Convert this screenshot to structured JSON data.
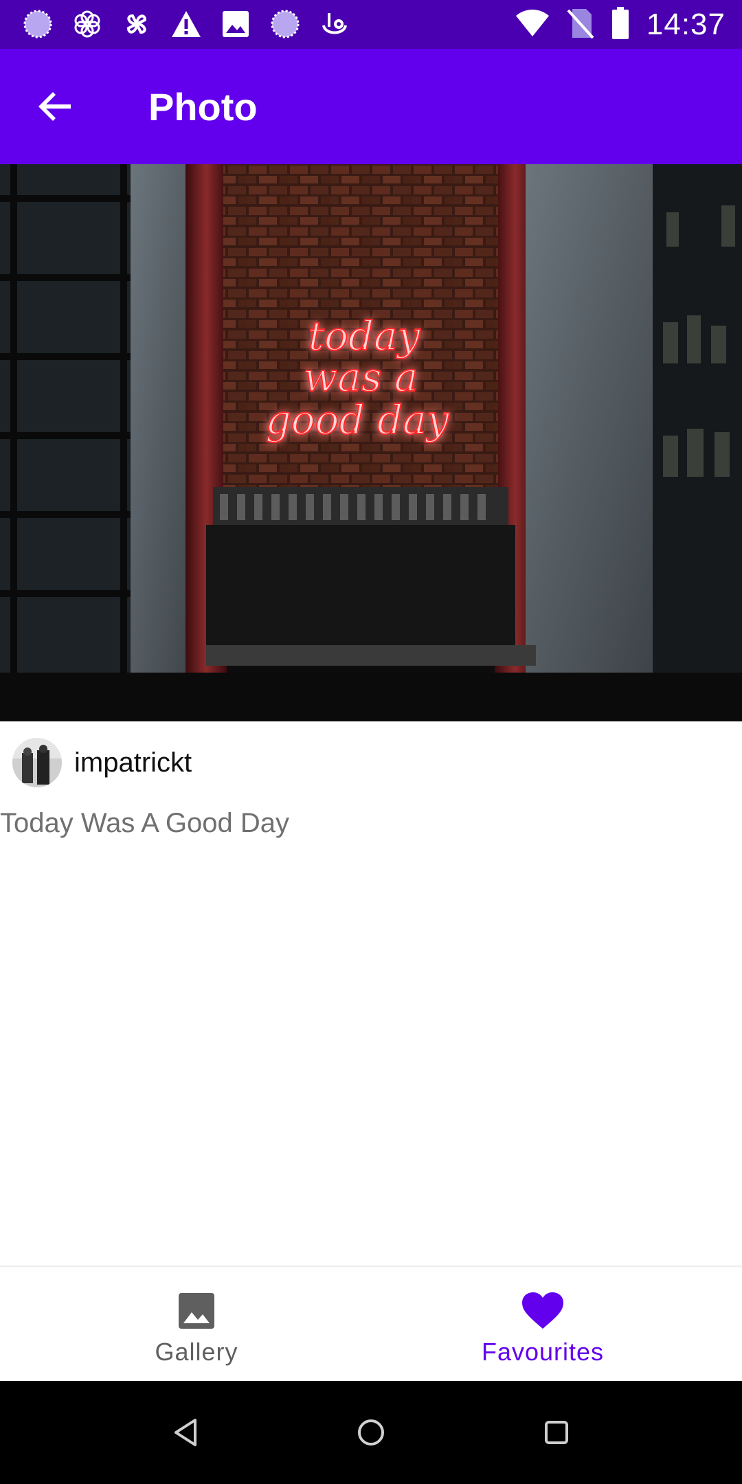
{
  "status_bar": {
    "time": "14:37",
    "left_icons": [
      "circle-spinner-icon",
      "flower-icon",
      "pinwheel-icon",
      "warning-icon",
      "image-icon",
      "circle-spinner-icon",
      "touch-icon"
    ],
    "right_icons": [
      "wifi-icon",
      "no-sim-icon",
      "battery-icon"
    ]
  },
  "app_bar": {
    "title": "Photo",
    "back_icon": "arrow-back-icon"
  },
  "photo": {
    "neon_lines": [
      "today",
      "was a",
      "good day"
    ],
    "alt_colors": {
      "neon": "#ff2a2a",
      "brick": "#5a2a1c"
    }
  },
  "author": {
    "username": "impatrickt"
  },
  "description": "Today Was A Good Day",
  "bottom_nav": {
    "items": [
      {
        "label": "Gallery",
        "icon": "image-icon",
        "active": false
      },
      {
        "label": "Favourites",
        "icon": "heart-icon",
        "active": true
      }
    ]
  },
  "colors": {
    "status_bar": "#4a00b0",
    "primary": "#6200ee",
    "inactive": "#5f5f5f"
  }
}
